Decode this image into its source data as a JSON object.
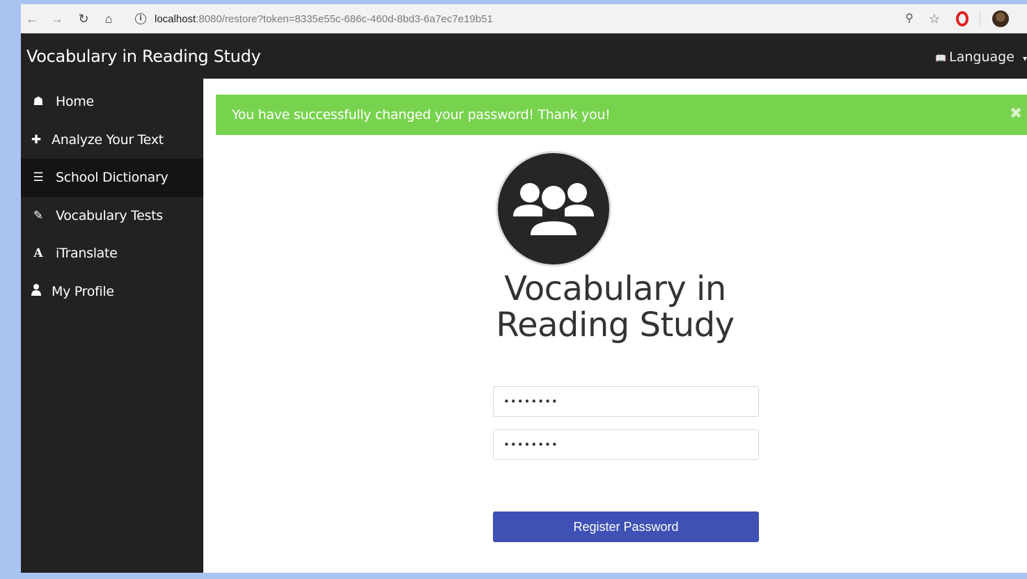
{
  "browser": {
    "back_icon": "arrow-left-icon",
    "forward_icon": "arrow-right-icon",
    "reload_icon": "reload-icon",
    "home_icon": "home-icon",
    "url_host": "localhost",
    "url_rest": ":8080/restore?token=8335e55c-686c-460d-8bd3-6a7ec7e19b51"
  },
  "header": {
    "title": "Vocabulary in Reading Study",
    "language_label": "Language"
  },
  "sidebar": {
    "items": [
      {
        "label": "Home",
        "icon": "home-icon",
        "glyph": "☗"
      },
      {
        "label": "Analyze Your Text",
        "icon": "plus-icon",
        "glyph": "✚"
      },
      {
        "label": "School Dictionary",
        "icon": "list-icon",
        "glyph": "☰"
      },
      {
        "label": "Vocabulary Tests",
        "icon": "edit-icon",
        "glyph": "✎"
      },
      {
        "label": "iTranslate",
        "icon": "font-icon",
        "glyph": "A"
      },
      {
        "label": "My Profile",
        "icon": "user-icon",
        "glyph": "●"
      }
    ],
    "active_index": 2
  },
  "alert": {
    "message": "You have successfully changed your password! Thank you!",
    "close": "✖"
  },
  "main": {
    "title_line1": "Vocabulary in",
    "title_line2": "Reading Study",
    "password_value": "••••••••",
    "confirm_value": "••••••••",
    "register_label": "Register Password"
  },
  "colors": {
    "header_bg": "#222222",
    "alert_bg": "#77d34d",
    "button_bg": "#3f51b5"
  }
}
